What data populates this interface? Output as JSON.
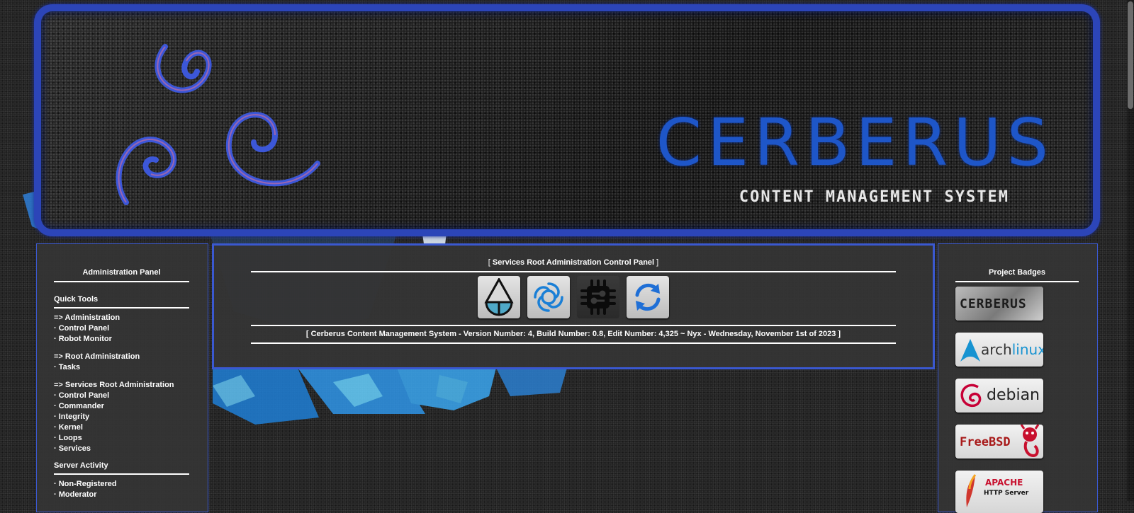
{
  "banner": {
    "logo_title": "CERBERUS",
    "logo_subtitle": "CONTENT MANAGEMENT SYSTEM"
  },
  "left_panel": {
    "title": "Administration Panel",
    "quick_tools": {
      "heading": "Quick Tools",
      "groups": [
        {
          "items": [
            "=> Administration",
            "· Control Panel",
            "· Robot Monitor"
          ]
        },
        {
          "items": [
            "=> Root Administration",
            "· Tasks"
          ]
        },
        {
          "items": [
            "=> Services Root Administration",
            "· Control Panel",
            "· Commander",
            "· Integrity",
            "· Kernel",
            "· Loops",
            "· Services"
          ]
        }
      ]
    },
    "server_activity": {
      "heading": "Server Activity",
      "items": [
        "· Non-Registered",
        "· Moderator"
      ]
    }
  },
  "center_panel": {
    "title_prefix": "[",
    "title": "Services Root Administration Control Panel",
    "title_suffix": "]",
    "icons": [
      "drop-shield-icon",
      "swirl-icon",
      "chip-icon",
      "refresh-icon"
    ],
    "version_line": "[ Cerberus Content Management System - Version Number: 4, Build Number: 0.8, Edit Number: 4,325 ~ Nyx - Wednesday, November 1st of 2023 ]"
  },
  "right_panel": {
    "title": "Project Badges",
    "badges": [
      {
        "name": "cerberus",
        "text": "CERBERUS"
      },
      {
        "name": "archlinux",
        "text_a": "arch",
        "text_b": "linux"
      },
      {
        "name": "debian",
        "text": "debian"
      },
      {
        "name": "freebsd",
        "text": "FreeBSD"
      },
      {
        "name": "apache",
        "text_a": "APACHE",
        "text_b": "HTTP Server"
      }
    ]
  },
  "colors": {
    "accent_blue": "#2c45b8",
    "panel_bg": "#343434",
    "logo_blue": "#1e56c8"
  }
}
